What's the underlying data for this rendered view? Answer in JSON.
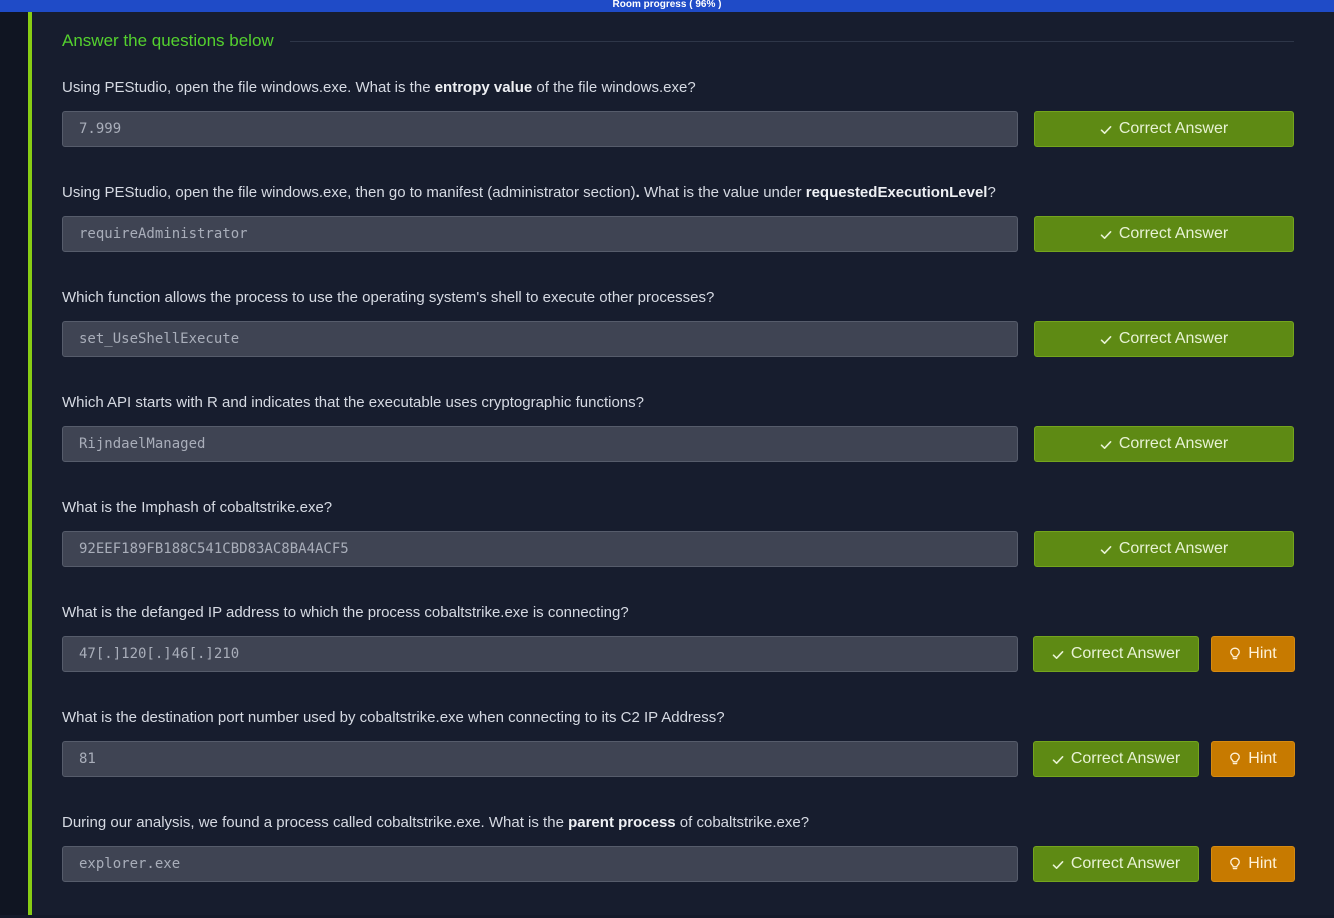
{
  "header": {
    "progress_label": "Room progress ( 96% )"
  },
  "section": {
    "title": "Answer the questions below"
  },
  "buttons": {
    "correct_label": "Correct Answer",
    "hint_label": "Hint"
  },
  "colors": {
    "accent": "#88cc14",
    "progress": "#1f4bc7",
    "correct_button": "#5e8a14",
    "hint_button": "#c77a00",
    "title": "#54d12e"
  },
  "icons": {
    "correct": "check-icon",
    "hint": "lightbulb-icon"
  },
  "questions": [
    {
      "parts": [
        {
          "t": "Using PEStudio, open the file windows.exe. What is the "
        },
        {
          "t": "entropy value",
          "b": true
        },
        {
          "t": " of the file windows.exe?"
        }
      ],
      "answer": "7.999",
      "has_hint": false
    },
    {
      "parts": [
        {
          "t": "Using PEStudio, open the file windows.exe, then go to manifest (administrator section)"
        },
        {
          "t": ".",
          "b": true
        },
        {
          "t": " What is the value under "
        },
        {
          "t": "requestedExecutionLevel",
          "b": true
        },
        {
          "t": "?"
        }
      ],
      "answer": "requireAdministrator",
      "has_hint": false
    },
    {
      "parts": [
        {
          "t": "Which function allows the process to use the operating system's shell to execute other processes?"
        }
      ],
      "answer": "set_UseShellExecute",
      "has_hint": false
    },
    {
      "parts": [
        {
          "t": "Which API starts with R and indicates that the executable uses cryptographic functions?"
        }
      ],
      "answer": "RijndaelManaged",
      "has_hint": false
    },
    {
      "parts": [
        {
          "t": "What is the Imphash of cobaltstrike.exe?"
        }
      ],
      "answer": "92EEF189FB188C541CBD83AC8BA4ACF5",
      "has_hint": false
    },
    {
      "parts": [
        {
          "t": "What is the defanged IP address to which the process cobaltstrike.exe is connecting?"
        }
      ],
      "answer": "47[.]120[.]46[.]210",
      "has_hint": true
    },
    {
      "parts": [
        {
          "t": "What is the destination port number used by cobaltstrike.exe when connecting to its C2 IP Address?"
        }
      ],
      "answer": "81",
      "has_hint": true
    },
    {
      "parts": [
        {
          "t": "During our analysis, we found a process called cobaltstrike.exe. What is the "
        },
        {
          "t": "parent process",
          "b": true
        },
        {
          "t": " of cobaltstrike.exe?"
        }
      ],
      "answer": "explorer.exe",
      "has_hint": true
    }
  ]
}
